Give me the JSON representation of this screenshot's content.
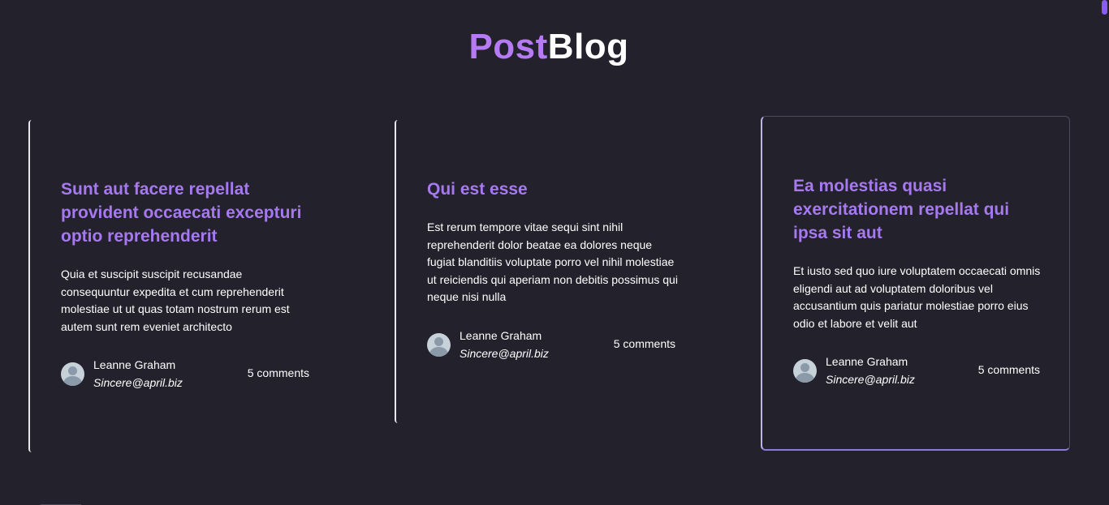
{
  "brand": {
    "part1": "Post",
    "part2": "Blog"
  },
  "posts": [
    {
      "title": "Sunt aut facere repellat provident occaecati excepturi optio reprehenderit",
      "body": "Quia et suscipit suscipit recusandae consequuntur expedita et cum reprehenderit molestiae ut ut quas totam nostrum rerum est autem sunt rem eveniet architecto",
      "author": "Leanne Graham",
      "email": "Sincere@april.biz",
      "comments": "5 comments"
    },
    {
      "title": "Qui est esse",
      "body": "Est rerum tempore vitae sequi sint nihil reprehenderit dolor beatae ea dolores neque fugiat blanditiis voluptate porro vel nihil molestiae ut reiciendis qui aperiam non debitis possimus qui neque nisi nulla",
      "author": "Leanne Graham",
      "email": "Sincere@april.biz",
      "comments": "5 comments"
    },
    {
      "title": "Ea molestias quasi exercitationem repellat qui ipsa sit aut",
      "body": "Et iusto sed quo iure voluptatem occaecati omnis eligendi aut ad voluptatem doloribus vel accusantium quis pariatur molestiae porro eius odio et labore et velit aut",
      "author": "Leanne Graham",
      "email": "Sincere@april.biz",
      "comments": "5 comments"
    }
  ],
  "colors": {
    "background": "#23212b",
    "accent": "#a679f0",
    "brand_accent": "#b57af4",
    "scrollbar": "#8a5cf5"
  },
  "icons": {
    "avatar": "user-avatar-icon"
  }
}
